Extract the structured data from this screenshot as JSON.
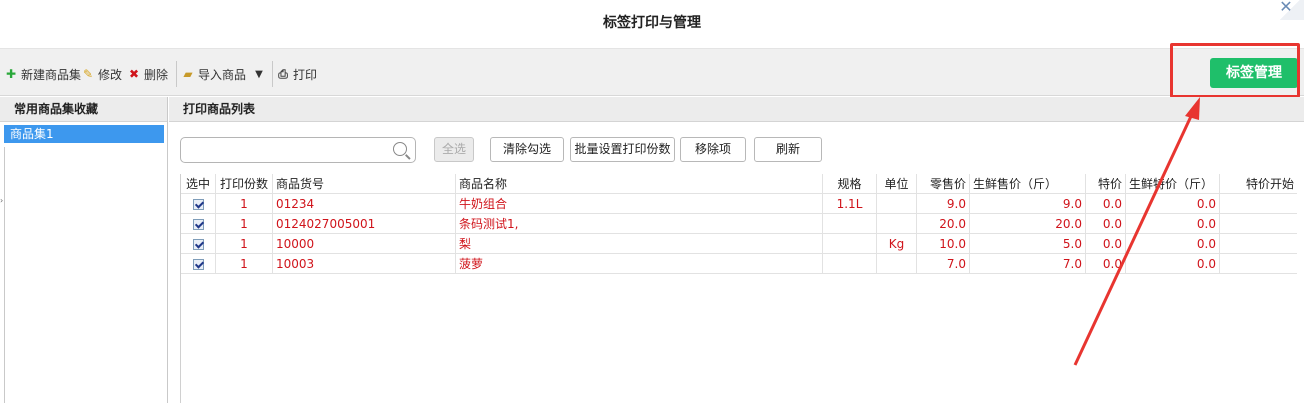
{
  "window": {
    "title": "标签打印与管理",
    "close_icon": "close-icon"
  },
  "toolbar": {
    "new_set": "新建商品集",
    "edit": "修改",
    "delete": "删除",
    "import": "导入商品",
    "print": "打印",
    "label_manage": "标签管理"
  },
  "left_panel": {
    "header": "常用商品集收藏",
    "items": [
      {
        "label": "商品集1"
      }
    ]
  },
  "right_panel": {
    "header": "打印商品列表",
    "search": {
      "placeholder": "",
      "value": ""
    },
    "buttons": {
      "select_all": "全选",
      "clear": "清除勾选",
      "batch": "批量设置打印份数",
      "remove": "移除项",
      "refresh": "刷新"
    }
  },
  "table": {
    "columns": [
      "选中",
      "打印份数",
      "商品货号",
      "商品名称",
      "规格",
      "单位",
      "零售价",
      "生鲜售价（斤）",
      "特价",
      "生鲜特价（斤）",
      "特价开始"
    ],
    "header_display": [
      "选中",
      "打印份数",
      "商品货号",
      "商品名称",
      "规格",
      "单位",
      "零售价",
      "生鲜售价（斤）",
      "特价",
      "生鲜特价（斤）",
      "特价开始"
    ],
    "rows": [
      {
        "checked": true,
        "copies": "1",
        "code": "01234",
        "name": "牛奶组合",
        "spec": "1.1L",
        "unit": "",
        "price": "9.0",
        "fresh_price": "9.0",
        "special": "0.0",
        "fresh_special": "0.0"
      },
      {
        "checked": true,
        "copies": "1",
        "code": "0124027005001",
        "name": "条码测试1,",
        "spec": "",
        "unit": "",
        "price": "20.0",
        "fresh_price": "20.0",
        "special": "0.0",
        "fresh_special": "0.0"
      },
      {
        "checked": true,
        "copies": "1",
        "code": "10000",
        "name": "梨",
        "spec": "",
        "unit": "Kg",
        "price": "10.0",
        "fresh_price": "5.0",
        "special": "0.0",
        "fresh_special": "0.0"
      },
      {
        "checked": true,
        "copies": "1",
        "code": "10003",
        "name": "菠萝",
        "spec": "",
        "unit": "",
        "price": "7.0",
        "fresh_price": "7.0",
        "special": "0.0",
        "fresh_special": "0.0"
      }
    ]
  },
  "colors": {
    "accent": "#1fbf6a",
    "selection": "#3d98ee",
    "data_text": "#d0141b",
    "annotation": "#e83530"
  },
  "icons": {
    "add": "plus-icon",
    "edit": "pencil-icon",
    "delete": "x-icon",
    "import": "folder-icon",
    "dropdown": "caret-down-icon",
    "print": "printer-icon",
    "search": "search-icon"
  }
}
